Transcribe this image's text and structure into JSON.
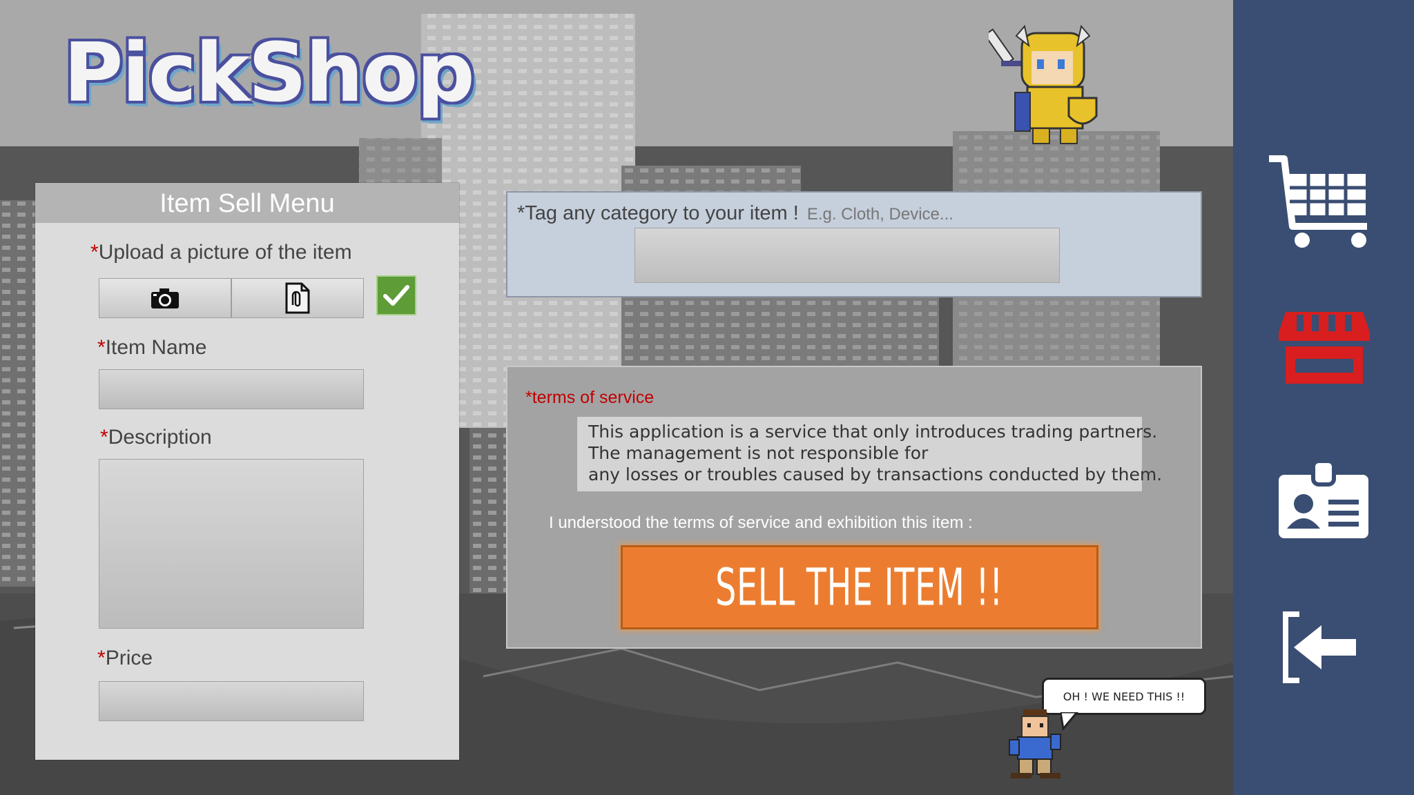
{
  "app": {
    "logo_text": "PickShop"
  },
  "sell_menu": {
    "title": "Item Sell Menu",
    "required_mark": "*",
    "upload_label": "Upload a picture of the item",
    "upload_buttons": [
      "camera-icon",
      "attach-file-icon"
    ],
    "upload_status_icon": "check-icon",
    "item_name_label": "Item Name",
    "item_name_value": "",
    "description_label": "Description",
    "description_value": "",
    "price_label": "Price",
    "price_value": ""
  },
  "tag": {
    "label": "*Tag any category to your item !",
    "placeholder": "E.g. Cloth, Device...",
    "value": ""
  },
  "terms": {
    "label": "*terms of service",
    "lines": [
      "This application is a service that only introduces trading partners.",
      "The management is not responsible for",
      "any losses or troubles caused by transactions conducted by them."
    ],
    "agree_text": "I understood the terms of service and exhibition this item :",
    "sell_button": "SELL THE ITEM !!"
  },
  "character": {
    "speech": "OH ! WE NEED THIS !!"
  },
  "sidebar": {
    "items": [
      {
        "icon": "shopping-cart-icon",
        "active": false
      },
      {
        "icon": "store-icon",
        "active": true
      },
      {
        "icon": "profile-card-icon",
        "active": false
      },
      {
        "icon": "logout-icon",
        "active": false
      }
    ]
  },
  "colors": {
    "accent": "#ec7d30",
    "required": "#c00000",
    "sidebar": "#3a4d72",
    "active_icon": "#d81e1e",
    "check": "#5e9c38"
  }
}
